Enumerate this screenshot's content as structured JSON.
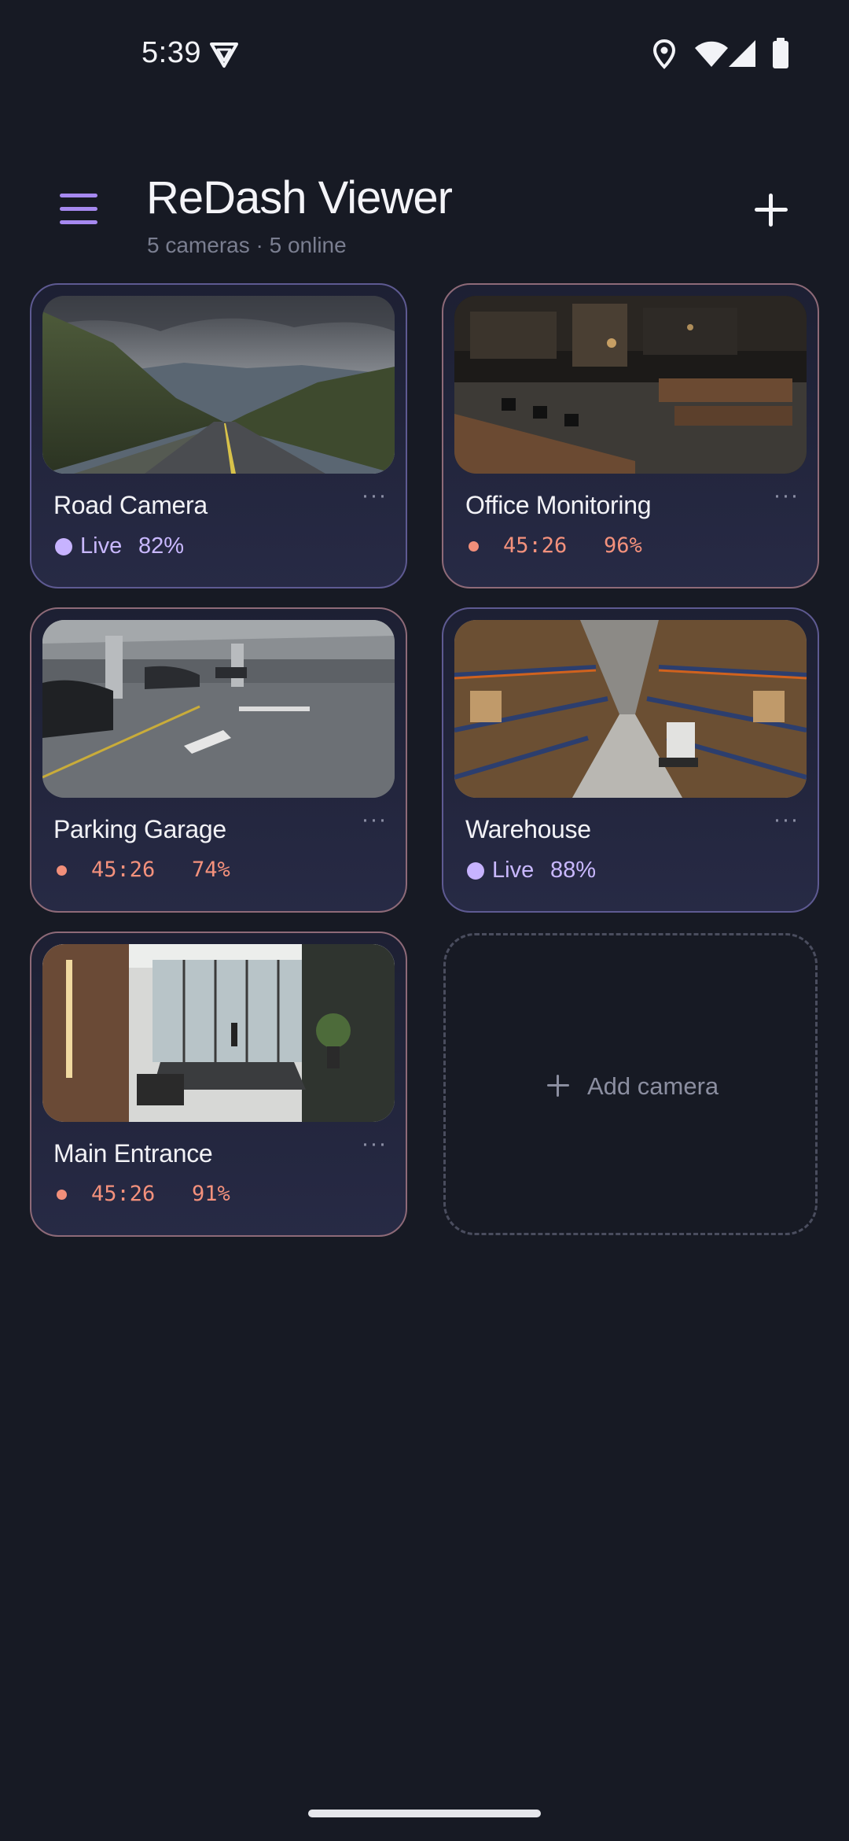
{
  "status_bar": {
    "time": "5:39",
    "icons": [
      "vpn-shield-icon",
      "location-icon",
      "wifi-icon",
      "signal-icon",
      "battery-icon"
    ]
  },
  "header": {
    "title": "ReDash Viewer",
    "subtitle": "5 cameras · 5 online",
    "menu_icon": "hamburger-menu-icon",
    "add_icon": "plus-icon"
  },
  "colors": {
    "background": "#171a24",
    "accent": "#a689f0",
    "live": "#c7b3ff",
    "recording": "#f4917c"
  },
  "cameras": [
    {
      "name": "Road Camera",
      "mode": "live",
      "status": "Live",
      "signal": "82%"
    },
    {
      "name": "Office Monitoring",
      "mode": "recording",
      "time": "45:26",
      "signal": "96%"
    },
    {
      "name": "Parking Garage",
      "mode": "recording",
      "time": "45:26",
      "signal": "74%"
    },
    {
      "name": "Warehouse",
      "mode": "live",
      "status": "Live",
      "signal": "88%"
    },
    {
      "name": "Main Entrance",
      "mode": "recording",
      "time": "45:26",
      "signal": "91%"
    }
  ],
  "more_icon": "more-dots-icon",
  "add_camera": {
    "label": "Add camera",
    "icon": "plus-icon"
  }
}
